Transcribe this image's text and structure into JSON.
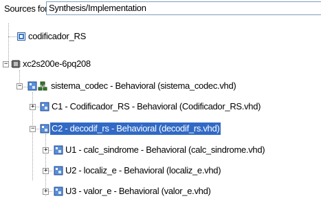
{
  "sources": {
    "label": "Sources for:",
    "value": "Synthesis/Implementation"
  },
  "tree": {
    "project": "codificador_RS",
    "device": "xc2s200e-6pq208",
    "top": "sistema_codec - Behavioral (sistema_codec.vhd)",
    "c1": "C1 - Codificador_RS - Behavioral (Codificador_RS.vhd)",
    "c2": "C2 - decodif_rs - Behavioral (decodif_rs.vhd)",
    "u1": "U1 - calc_sindrome - Behavioral (calc_sindrome.vhd)",
    "u2": "U2 - localiz_e - Behavioral (localiz_e.vhd)",
    "u3": "U3 - valor_e - Behavioral (valor_e.vhd)"
  },
  "colors": {
    "selection": "#316ac5"
  }
}
